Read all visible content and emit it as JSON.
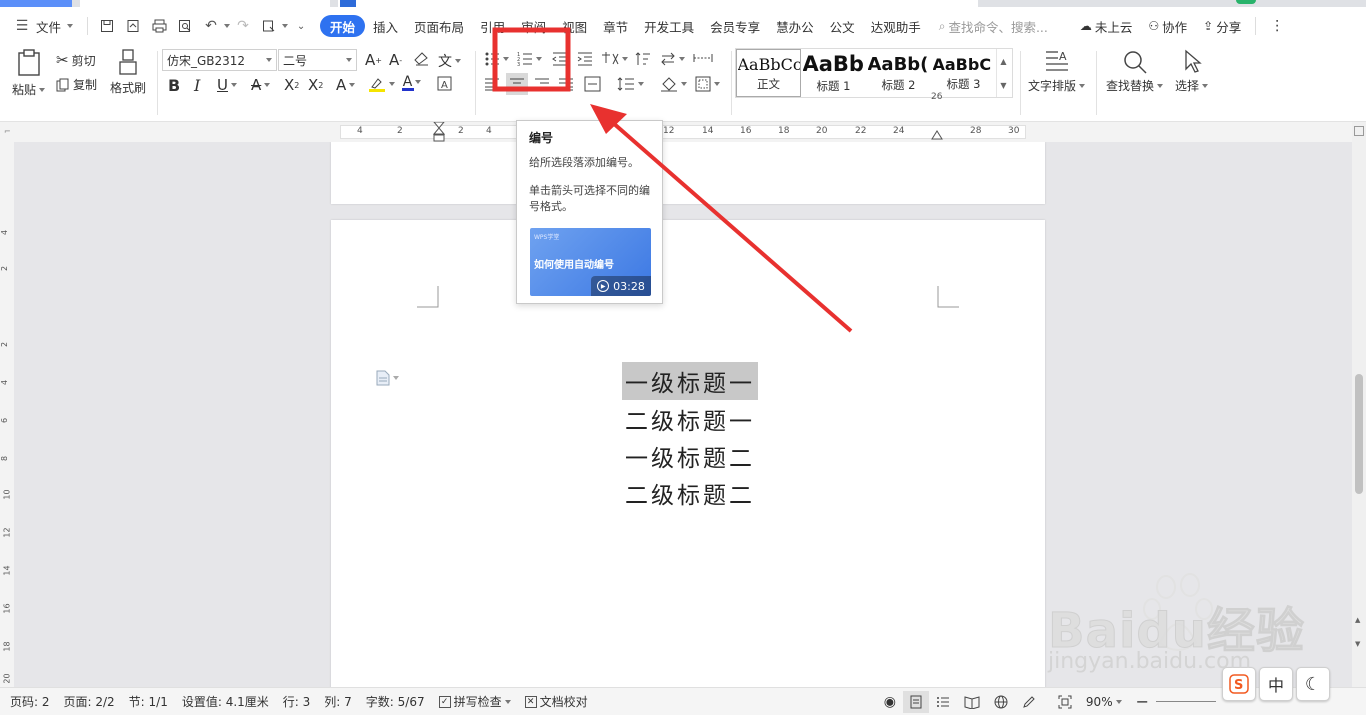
{
  "menubar": {
    "file_label": "文件",
    "tabs": [
      "开始",
      "插入",
      "页面布局",
      "引用",
      "审阅",
      "视图",
      "章节",
      "开发工具",
      "会员专享",
      "慧办公",
      "公文",
      "达观助手"
    ],
    "search_placeholder": "查找命令、搜索...",
    "cloud_label": "未上云",
    "collab_label": "协作",
    "share_label": "分享"
  },
  "ribbon": {
    "paste_label": "粘贴",
    "cut_label": "剪切",
    "copy_label": "复制",
    "format_painter_label": "格式刷",
    "font_name": "仿宋_GB2312",
    "font_size": "二号",
    "styles": [
      {
        "sample": "AaBbCc",
        "name": "正文"
      },
      {
        "sample": "AaBb",
        "name": "标题 1"
      },
      {
        "sample": "AaBb(",
        "name": "标题 2"
      },
      {
        "sample": "AaBbC",
        "name": "标题 3"
      }
    ],
    "text_layout_label": "文字排版",
    "find_replace_label": "查找替换",
    "select_label": "选择"
  },
  "ruler": {
    "h_ticks": [
      "4",
      "2",
      "2",
      "4",
      "12",
      "14",
      "16",
      "18",
      "20",
      "22",
      "24",
      "26",
      "28",
      "30"
    ],
    "v_ticks": [
      "4",
      "2",
      "2",
      "4",
      "6",
      "8",
      "10",
      "12",
      "14",
      "16",
      "18",
      "20"
    ]
  },
  "tooltip": {
    "title": "编号",
    "line1": "给所选段落添加编号。",
    "line2": "单击箭头可选择不同的编号格式。",
    "video_watermark": "WPS学堂",
    "video_title": "如何使用自动编号",
    "video_duration": "03:28"
  },
  "document": {
    "headings": [
      "一级标题一",
      "二级标题一",
      "一级标题二",
      "二级标题二"
    ]
  },
  "statusbar": {
    "page_no": "页码: 2",
    "pages": "页面: 2/2",
    "section": "节: 1/1",
    "setting": "设置值: 4.1厘米",
    "row": "行: 3",
    "col": "列: 7",
    "word_count": "字数: 5/67",
    "spell_check": "拼写检查",
    "doc_proof": "文档校对",
    "zoom": "90%"
  },
  "ime": {
    "mode": "中"
  },
  "watermark": {
    "brand": "Baidu经验",
    "url": "jingyan.baidu.com"
  },
  "colors": {
    "accent": "#2e72f0",
    "annotation_red": "#e8312f"
  }
}
